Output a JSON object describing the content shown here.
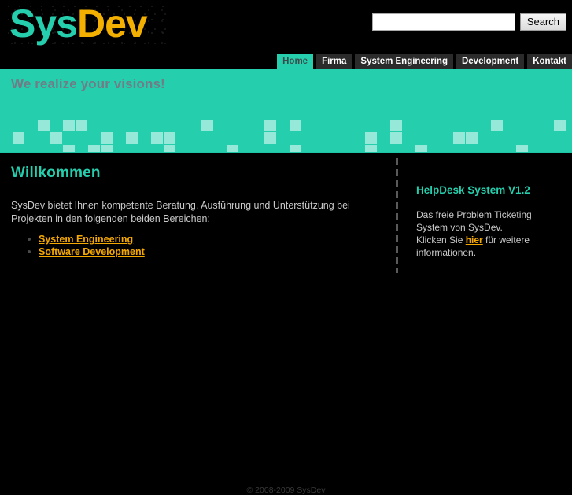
{
  "colors": {
    "background": "#000000",
    "accent_teal": "#25cfae",
    "accent_amber": "#f4a800",
    "logo_amber": "#f4b000",
    "checker": "#96e9d8",
    "tagline_text": "#707d86",
    "nav_inactive_bg": "#2b2b2b",
    "body_text": "#c9c9c9",
    "footer_text": "#3a3a3a"
  },
  "header": {
    "logo": {
      "part1": "Sys",
      "part2": "Dev"
    },
    "search": {
      "value": "",
      "placeholder": "",
      "button_label": "Search"
    }
  },
  "nav": {
    "items": [
      {
        "label": "Home",
        "active": true
      },
      {
        "label": "Firma",
        "active": false
      },
      {
        "label": "System Engineering",
        "active": false
      },
      {
        "label": "Development",
        "active": false
      },
      {
        "label": "Kontakt",
        "active": false
      }
    ]
  },
  "band": {
    "tagline": "We realize your visions!",
    "checker_squares": [
      [
        3,
        0
      ],
      [
        5,
        0
      ],
      [
        6,
        0
      ],
      [
        16,
        0
      ],
      [
        21,
        0
      ],
      [
        31,
        0
      ],
      [
        39,
        0
      ],
      [
        44,
        0
      ],
      [
        23,
        0
      ],
      [
        1,
        1
      ],
      [
        4,
        1
      ],
      [
        8,
        1
      ],
      [
        10,
        1
      ],
      [
        12,
        1
      ],
      [
        13,
        1
      ],
      [
        21,
        1
      ],
      [
        29,
        1
      ],
      [
        31,
        1
      ],
      [
        36,
        1
      ],
      [
        37,
        1
      ],
      [
        5,
        2
      ],
      [
        7,
        2
      ],
      [
        8,
        2
      ],
      [
        13,
        2
      ],
      [
        18,
        2
      ],
      [
        23,
        2
      ],
      [
        29,
        2
      ],
      [
        33,
        2
      ],
      [
        41,
        2
      ]
    ]
  },
  "main": {
    "title": "Willkommen",
    "intro": "SysDev bietet Ihnen kompetente Beratung, Ausführung und Unterstützung bei Projekten in den folgenden beiden Bereichen:",
    "links": [
      "System Engineering",
      "Software Development"
    ]
  },
  "sidebar": {
    "title": "HelpDesk System V1.2",
    "text_line1": "Das freie Problem Ticketing System",
    "text_line2": "von SysDev.",
    "text_before_link": "Klicken Sie ",
    "link_label": "hier",
    "text_after_link": " für weitere",
    "text_line4": "informationen."
  },
  "footer": {
    "copyright": "© 2008-2009 SysDev"
  }
}
